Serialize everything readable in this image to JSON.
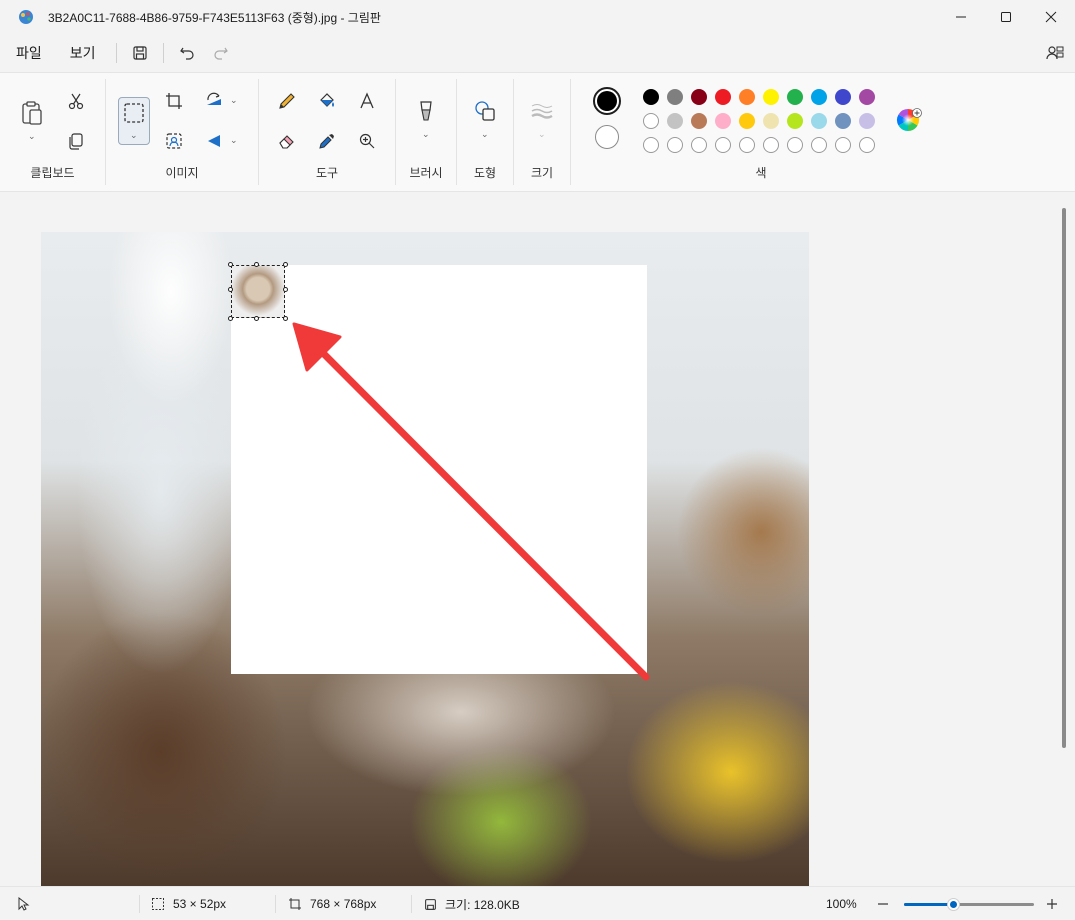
{
  "window": {
    "title": "3B2A0C11-7688-4B86-9759-F743E5113F63 (중형).jpg - 그림판",
    "app_icon": "paint-app-icon",
    "controls": [
      "minimize-icon",
      "maximize-icon",
      "close-icon"
    ]
  },
  "menu": {
    "file": "파일",
    "view": "보기",
    "quick_actions": [
      "save-icon",
      "undo-icon",
      "redo-icon"
    ],
    "right_icon": "account-icon"
  },
  "ribbon": {
    "clipboard": {
      "label": "클립보드",
      "icons": [
        "paste-icon",
        "cut-icon",
        "copy-icon"
      ]
    },
    "image": {
      "label": "이미지",
      "icons": [
        "select-icon",
        "crop-icon",
        "rotate-icon",
        "flip-icon",
        "remove-background-icon"
      ]
    },
    "tools": {
      "label": "도구",
      "icons": [
        "pencil-icon",
        "fill-icon",
        "text-icon",
        "eraser-icon",
        "color-picker-icon",
        "magnifier-icon"
      ]
    },
    "brush": {
      "label": "브러시",
      "icon": "brush-icon"
    },
    "shapes": {
      "label": "도형",
      "icon": "shapes-icon"
    },
    "size": {
      "label": "크기",
      "icon": "size-icon"
    },
    "colors": {
      "label": "색",
      "primary": "#000000",
      "secondary": "#ffffff",
      "row1": [
        "#000000",
        "#7f7f7f",
        "#880015",
        "#ed1c24",
        "#ff7f27",
        "#fff200",
        "#22b14c",
        "#00a2e8",
        "#3f48cc",
        "#a349a4"
      ],
      "row2": [
        "#ffffff",
        "#c3c3c3",
        "#b97a57",
        "#ffaec9",
        "#ffc90e",
        "#efe4b0",
        "#b5e61d",
        "#99d9ea",
        "#7092be",
        "#c8bfe7"
      ],
      "row3_empty_count": 10,
      "edit_colors_icon": "color-wheel-icon"
    }
  },
  "canvas": {
    "annotation": "red-arrow",
    "arrow_color": "#f03a3a"
  },
  "status": {
    "selection_size": "53 × 52px",
    "canvas_size": "768 × 768px",
    "file_size": "크기: 128.0KB",
    "zoom": "100%",
    "zoom_fraction": 0.38
  }
}
